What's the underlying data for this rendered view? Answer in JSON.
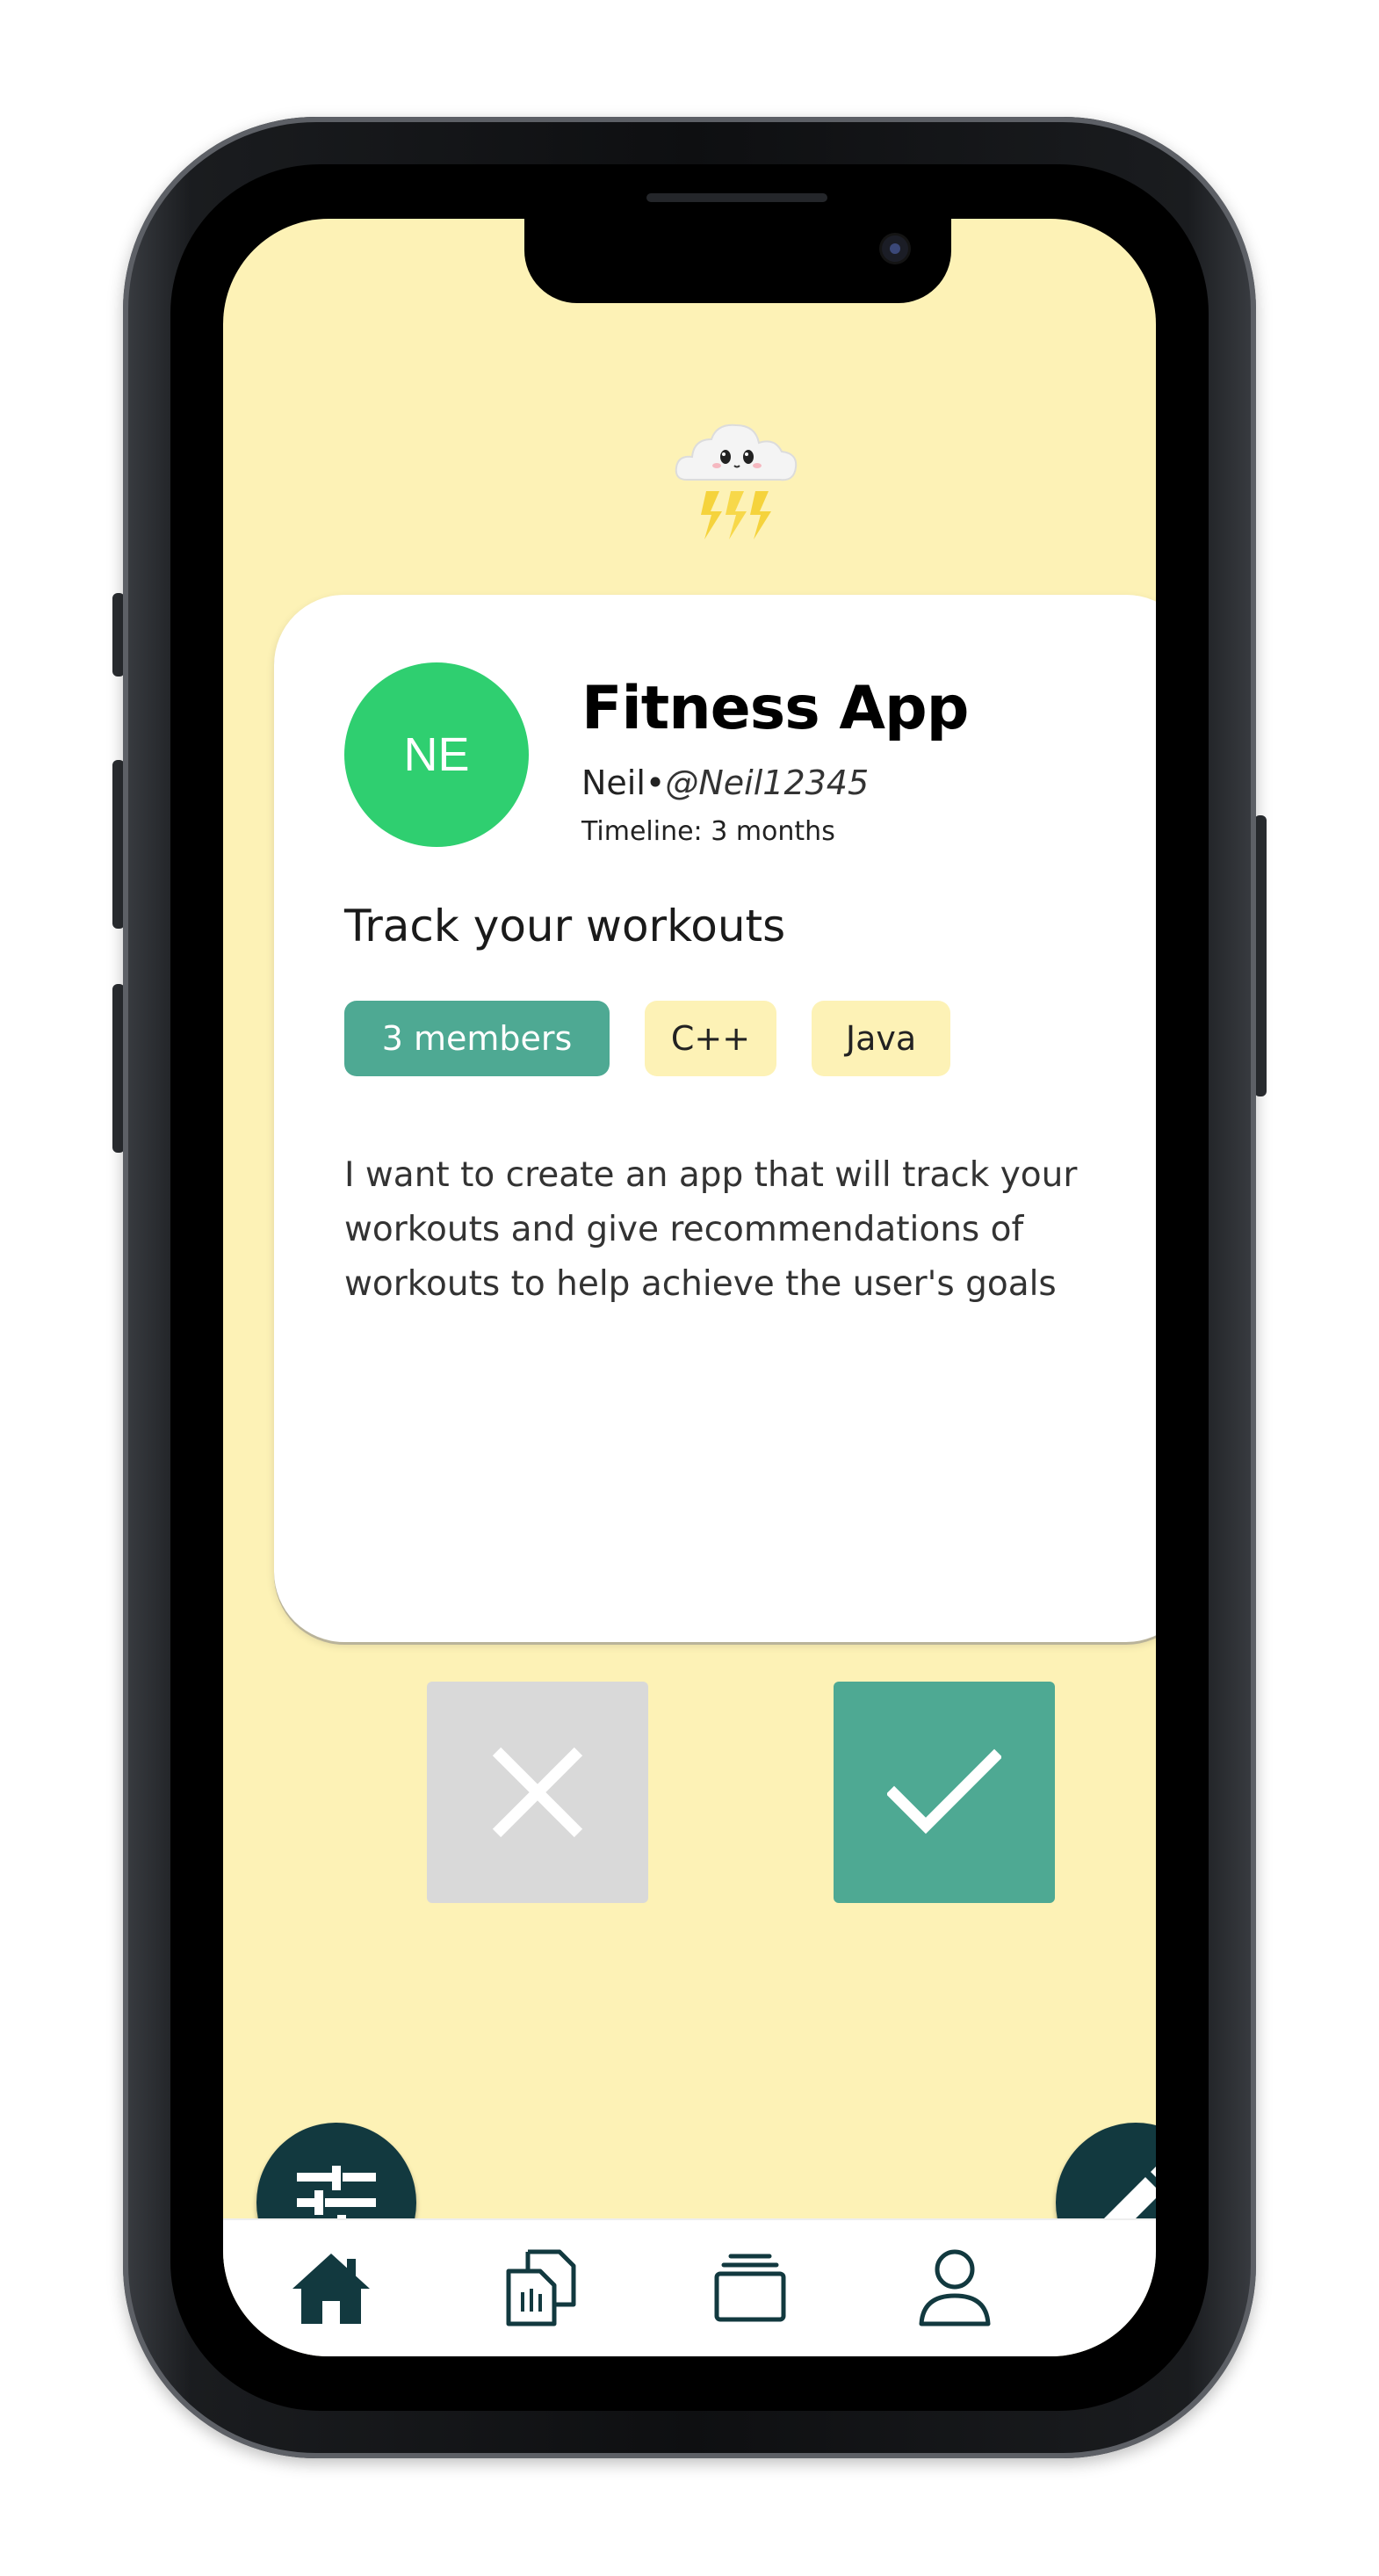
{
  "card": {
    "avatar_initials": "NE",
    "title": "Fitness App",
    "author_name": "Neil",
    "separator": "•",
    "author_handle": "@Neil12345",
    "timeline": "Timeline: 3 months",
    "tagline": "Track your workouts",
    "members_chip": "3 members",
    "languages": [
      "C++",
      "Java"
    ],
    "description": "I want to create an app that will track your workouts and give recommendations of workouts to help achieve the user's goals"
  },
  "colors": {
    "background": "#fdf2b6",
    "avatar": "#2fcf70",
    "accent": "#4ea993",
    "fab": "#12393f",
    "reject": "#d9d9d9"
  },
  "icons": {
    "logo": "storm-cloud-icon",
    "reject": "close-icon",
    "accept": "check-icon",
    "filter": "sliders-icon",
    "edit": "pencil-icon",
    "nav": [
      "home-icon",
      "documents-icon",
      "stack-icon",
      "profile-icon"
    ]
  }
}
